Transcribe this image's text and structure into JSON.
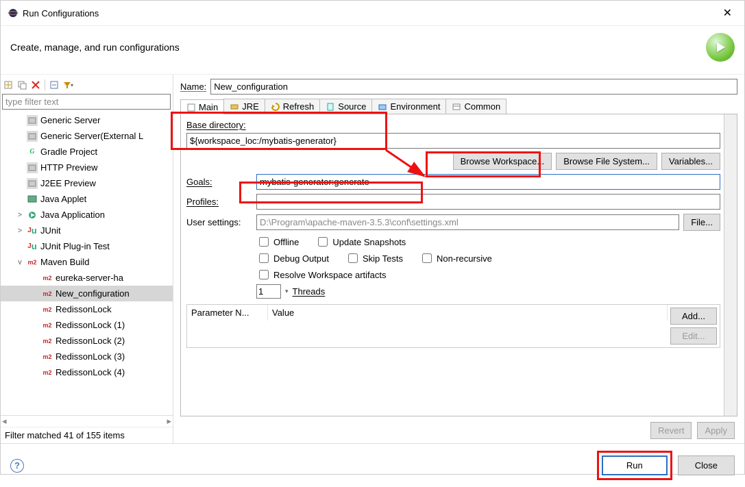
{
  "window": {
    "title": "Run Configurations",
    "subtitle": "Create, manage, and run configurations"
  },
  "left": {
    "filter_placeholder": "type filter text",
    "status": "Filter matched 41 of 155 items",
    "items": [
      {
        "label": "Generic Server",
        "icon": "srv"
      },
      {
        "label": "Generic Server(External L",
        "icon": "srv"
      },
      {
        "label": "Gradle Project",
        "icon": "gradle"
      },
      {
        "label": "HTTP Preview",
        "icon": "srv"
      },
      {
        "label": "J2EE Preview",
        "icon": "srv"
      },
      {
        "label": "Java Applet",
        "icon": "applet"
      },
      {
        "label": "Java Application",
        "icon": "japp",
        "twisty": ">"
      },
      {
        "label": "JUnit",
        "icon": "junit",
        "twisty": ">"
      },
      {
        "label": "JUnit Plug-in Test",
        "icon": "junit"
      },
      {
        "label": "Maven Build",
        "icon": "m2",
        "twisty": "v"
      },
      {
        "label": "eureka-server-ha",
        "icon": "m2",
        "indent": 2
      },
      {
        "label": "New_configuration",
        "icon": "m2",
        "indent": 2,
        "selected": true
      },
      {
        "label": "RedissonLock",
        "icon": "m2",
        "indent": 2
      },
      {
        "label": "RedissonLock (1)",
        "icon": "m2",
        "indent": 2
      },
      {
        "label": "RedissonLock (2)",
        "icon": "m2",
        "indent": 2
      },
      {
        "label": "RedissonLock (3)",
        "icon": "m2",
        "indent": 2
      },
      {
        "label": "RedissonLock (4)",
        "icon": "m2",
        "indent": 2
      }
    ]
  },
  "form": {
    "name_label": "Name:",
    "name_value": "New_configuration",
    "tabs": [
      "Main",
      "JRE",
      "Refresh",
      "Source",
      "Environment",
      "Common"
    ],
    "base_dir_label": "Base directory:",
    "base_dir_value": "${workspace_loc:/mybatis-generator}",
    "browse_ws": "Browse Workspace...",
    "browse_fs": "Browse File System...",
    "variables": "Variables...",
    "goals_label": "Goals:",
    "goals_value": "mybatis-generator:generate",
    "profiles_label": "Profiles:",
    "profiles_value": "",
    "user_settings_label": "User settings:",
    "user_settings_value": "D:\\Program\\apache-maven-3.5.3\\conf\\settings.xml",
    "file_btn": "File...",
    "checks": {
      "offline": "Offline",
      "update_snapshots": "Update Snapshots",
      "debug_output": "Debug Output",
      "skip_tests": "Skip Tests",
      "non_recursive": "Non-recursive",
      "resolve_ws": "Resolve Workspace artifacts"
    },
    "threads_value": "1",
    "threads_label": "Threads",
    "param_name": "Parameter N...",
    "param_value": "Value",
    "add_btn": "Add...",
    "edit_btn": "Edit...",
    "revert": "Revert",
    "apply": "Apply"
  },
  "footer": {
    "run": "Run",
    "close": "Close"
  }
}
